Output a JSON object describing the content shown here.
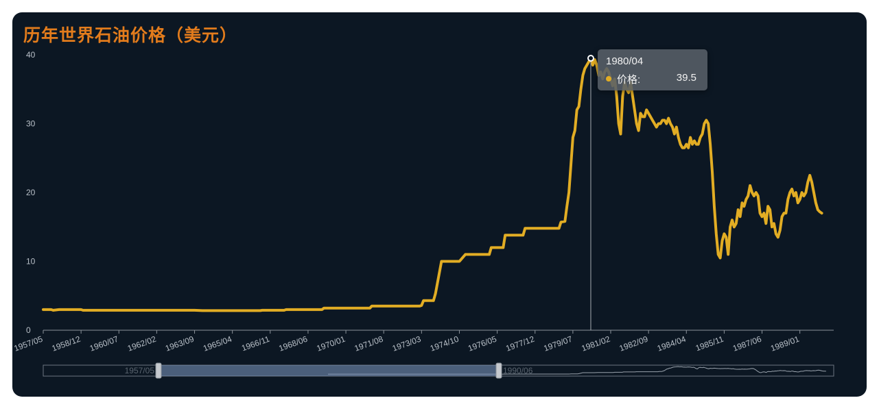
{
  "title": "历年世界石油价格（美元）",
  "colors": {
    "line": "#e2ad24",
    "title": "#e37c1c",
    "background": "#0c1723",
    "tooltip_marker": "#e2ad24"
  },
  "tooltip": {
    "date": "1980/04",
    "series_label": "价格:",
    "value": "39.5"
  },
  "slider": {
    "start_label": "1957/05",
    "end_label": "1990/06"
  },
  "chart_data": {
    "type": "line",
    "x_tick_labels": [
      "1957/05",
      "1958/12",
      "1960/07",
      "1962/02",
      "1963/09",
      "1965/04",
      "1966/11",
      "1968/06",
      "1970/01",
      "1971/08",
      "1973/03",
      "1974/10",
      "1976/05",
      "1977/12",
      "1979/07",
      "1981/02",
      "1982/09",
      "1984/04",
      "1985/11",
      "1987/06",
      "1989/01"
    ],
    "x_range": [
      "1957/05",
      "1990/06"
    ],
    "ylim": [
      0,
      40
    ],
    "y_ticks": [
      0,
      10,
      20,
      30,
      40
    ],
    "grid": false,
    "highlight": {
      "x": "1980/04",
      "y": 39.5
    },
    "series": [
      {
        "points": [
          [
            "1957/05",
            3.0
          ],
          [
            "1957/09",
            3.0
          ],
          [
            "1957/10",
            2.9
          ],
          [
            "1958/01",
            3.0
          ],
          [
            "1958/12",
            3.0
          ],
          [
            "1959/01",
            2.9
          ],
          [
            "1960/07",
            2.9
          ],
          [
            "1962/02",
            2.9
          ],
          [
            "1963/09",
            2.9
          ],
          [
            "1964/01",
            2.85
          ],
          [
            "1965/04",
            2.85
          ],
          [
            "1966/06",
            2.85
          ],
          [
            "1966/07",
            2.9
          ],
          [
            "1967/06",
            2.9
          ],
          [
            "1967/07",
            3.0
          ],
          [
            "1969/01",
            3.0
          ],
          [
            "1969/02",
            3.2
          ],
          [
            "1970/01",
            3.2
          ],
          [
            "1971/01",
            3.2
          ],
          [
            "1971/02",
            3.5
          ],
          [
            "1973/02",
            3.5
          ],
          [
            "1973/03",
            3.6
          ],
          [
            "1973/04",
            4.3
          ],
          [
            "1973/09",
            4.3
          ],
          [
            "1973/10",
            5.3
          ],
          [
            "1974/01",
            10.0
          ],
          [
            "1974/10",
            10.0
          ],
          [
            "1975/01",
            11.0
          ],
          [
            "1976/01",
            11.0
          ],
          [
            "1976/02",
            12.0
          ],
          [
            "1976/08",
            12.0
          ],
          [
            "1976/09",
            13.8
          ],
          [
            "1977/06",
            13.8
          ],
          [
            "1977/07",
            14.8
          ],
          [
            "1978/12",
            14.8
          ],
          [
            "1979/01",
            15.7
          ],
          [
            "1979/03",
            15.8
          ],
          [
            "1979/04",
            18.0
          ],
          [
            "1979/05",
            20.0
          ],
          [
            "1979/06",
            24.0
          ],
          [
            "1979/07",
            28.0
          ],
          [
            "1979/08",
            29.0
          ],
          [
            "1979/09",
            32.0
          ],
          [
            "1979/10",
            32.5
          ],
          [
            "1979/11",
            35.0
          ],
          [
            "1979/12",
            37.0
          ],
          [
            "1980/01",
            38.0
          ],
          [
            "1980/02",
            38.5
          ],
          [
            "1980/03",
            39.0
          ],
          [
            "1980/04",
            39.5
          ],
          [
            "1980/05",
            38.5
          ],
          [
            "1980/06",
            39.3
          ],
          [
            "1980/07",
            38.5
          ],
          [
            "1980/08",
            37.0
          ],
          [
            "1980/09",
            37.5
          ],
          [
            "1980/10",
            36.5
          ],
          [
            "1980/11",
            37.5
          ],
          [
            "1980/12",
            38.0
          ],
          [
            "1981/01",
            37.5
          ],
          [
            "1981/02",
            36.5
          ],
          [
            "1981/03",
            35.5
          ],
          [
            "1981/04",
            36.5
          ],
          [
            "1981/05",
            34.0
          ],
          [
            "1981/06",
            30.0
          ],
          [
            "1981/07",
            28.5
          ],
          [
            "1981/08",
            34.0
          ],
          [
            "1981/09",
            36.0
          ],
          [
            "1981/10",
            35.0
          ],
          [
            "1981/11",
            34.5
          ],
          [
            "1981/12",
            36.0
          ],
          [
            "1982/01",
            34.0
          ],
          [
            "1982/02",
            32.0
          ],
          [
            "1982/03",
            30.0
          ],
          [
            "1982/04",
            29.0
          ],
          [
            "1982/05",
            31.5
          ],
          [
            "1982/06",
            31.0
          ],
          [
            "1982/07",
            31.0
          ],
          [
            "1982/08",
            32.0
          ],
          [
            "1982/09",
            31.5
          ],
          [
            "1982/10",
            31.0
          ],
          [
            "1982/11",
            30.5
          ],
          [
            "1982/12",
            30.0
          ],
          [
            "1983/01",
            29.5
          ],
          [
            "1983/02",
            30.0
          ],
          [
            "1983/03",
            30.0
          ],
          [
            "1983/04",
            30.5
          ],
          [
            "1983/05",
            30.5
          ],
          [
            "1983/06",
            30.0
          ],
          [
            "1983/07",
            30.8
          ],
          [
            "1983/08",
            30.0
          ],
          [
            "1983/09",
            29.5
          ],
          [
            "1983/10",
            28.5
          ],
          [
            "1983/11",
            29.5
          ],
          [
            "1983/12",
            28.0
          ],
          [
            "1984/01",
            27.0
          ],
          [
            "1984/02",
            26.5
          ],
          [
            "1984/03",
            26.5
          ],
          [
            "1984/04",
            27.0
          ],
          [
            "1984/05",
            26.5
          ],
          [
            "1984/06",
            28.0
          ],
          [
            "1984/07",
            27.0
          ],
          [
            "1984/08",
            27.5
          ],
          [
            "1984/09",
            27.0
          ],
          [
            "1984/10",
            27.0
          ],
          [
            "1984/11",
            28.0
          ],
          [
            "1984/12",
            28.5
          ],
          [
            "1985/01",
            30.0
          ],
          [
            "1985/02",
            30.5
          ],
          [
            "1985/03",
            30.0
          ],
          [
            "1985/04",
            27.0
          ],
          [
            "1985/05",
            23.0
          ],
          [
            "1985/06",
            18.0
          ],
          [
            "1985/07",
            14.0
          ],
          [
            "1985/08",
            11.0
          ],
          [
            "1985/09",
            10.5
          ],
          [
            "1985/10",
            13.0
          ],
          [
            "1985/11",
            14.0
          ],
          [
            "1985/12",
            13.5
          ],
          [
            "1986/01",
            11.0
          ],
          [
            "1986/02",
            15.0
          ],
          [
            "1986/03",
            16.0
          ],
          [
            "1986/04",
            15.0
          ],
          [
            "1986/05",
            15.5
          ],
          [
            "1986/06",
            17.5
          ],
          [
            "1986/07",
            16.5
          ],
          [
            "1986/08",
            18.5
          ],
          [
            "1986/09",
            18.0
          ],
          [
            "1986/10",
            19.0
          ],
          [
            "1986/11",
            19.5
          ],
          [
            "1986/12",
            21.0
          ],
          [
            "1987/01",
            20.0
          ],
          [
            "1987/02",
            19.5
          ],
          [
            "1987/03",
            20.0
          ],
          [
            "1987/04",
            19.5
          ],
          [
            "1987/05",
            17.0
          ],
          [
            "1987/06",
            16.5
          ],
          [
            "1987/07",
            17.0
          ],
          [
            "1987/08",
            15.5
          ],
          [
            "1987/09",
            18.0
          ],
          [
            "1987/10",
            17.5
          ],
          [
            "1987/11",
            15.0
          ],
          [
            "1987/12",
            15.5
          ],
          [
            "1988/01",
            14.0
          ],
          [
            "1988/02",
            13.5
          ],
          [
            "1988/03",
            14.5
          ],
          [
            "1988/04",
            16.5
          ],
          [
            "1988/05",
            17.0
          ],
          [
            "1988/06",
            17.0
          ],
          [
            "1988/07",
            19.0
          ],
          [
            "1988/08",
            20.0
          ],
          [
            "1988/09",
            20.5
          ],
          [
            "1988/10",
            19.5
          ],
          [
            "1988/11",
            20.0
          ],
          [
            "1988/12",
            18.5
          ],
          [
            "1989/01",
            19.0
          ],
          [
            "1989/02",
            20.0
          ],
          [
            "1989/03",
            19.5
          ],
          [
            "1989/04",
            20.0
          ],
          [
            "1989/05",
            21.5
          ],
          [
            "1989/06",
            22.5
          ],
          [
            "1989/07",
            21.5
          ],
          [
            "1989/08",
            20.0
          ],
          [
            "1989/09",
            18.5
          ],
          [
            "1989/10",
            17.5
          ],
          [
            "1989/11",
            17.2
          ],
          [
            "1989/12",
            17.0
          ]
        ]
      }
    ]
  }
}
